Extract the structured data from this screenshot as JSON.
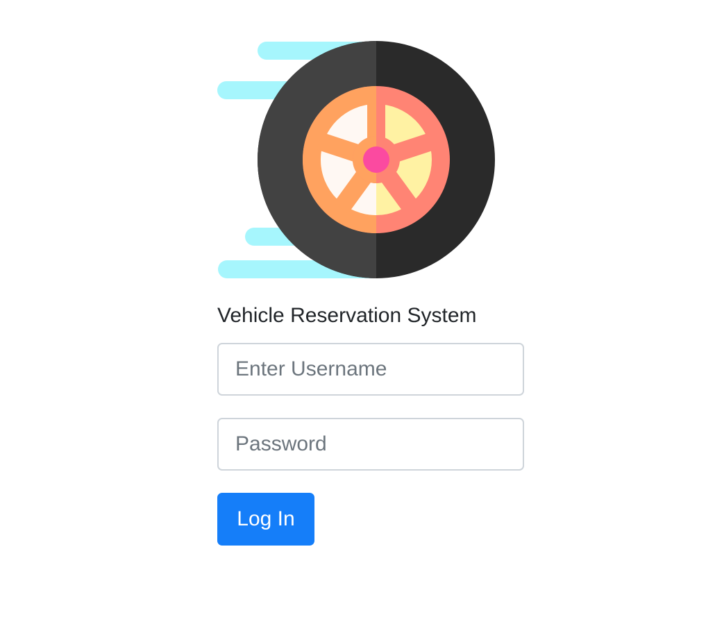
{
  "app": {
    "title": "Vehicle Reservation System"
  },
  "logo": {
    "icon": "speeding-wheel-icon",
    "colors": {
      "speed_lines": "#a6f6fd",
      "tire_left": "#424242",
      "tire_right": "#2a2a2a",
      "rim_left": "#ffa25f",
      "rim_right": "#ff8474",
      "spoke_gap_left": "#fff8f3",
      "spoke_gap_right": "#fff2a3",
      "hub": "#fb4aa0"
    }
  },
  "form": {
    "username_placeholder": "Enter Username",
    "username_value": "",
    "password_placeholder": "Password",
    "password_value": "",
    "login_label": "Log In"
  },
  "colors": {
    "primary": "#157ef9",
    "input_border": "#ced4da",
    "text": "#212529",
    "placeholder": "#6c757d"
  }
}
